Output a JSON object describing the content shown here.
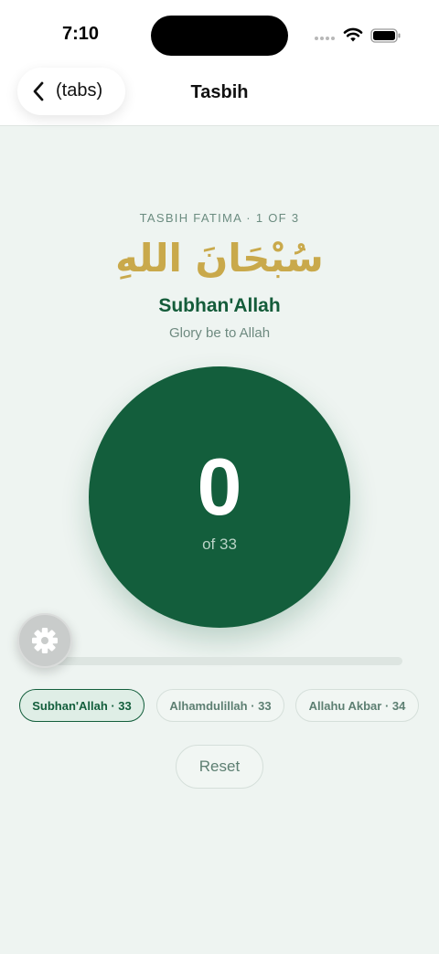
{
  "status_bar": {
    "time": "7:10"
  },
  "nav": {
    "back_label": "(tabs)",
    "title": "Tasbih"
  },
  "dhikr": {
    "set_label": "TASBIH FATIMA · 1 OF 3",
    "arabic": "سُبْحَانَ اللهِ",
    "transliteration": "Subhan'Allah",
    "meaning": "Glory be to Allah"
  },
  "counter": {
    "count": "0",
    "target_label": "of 33"
  },
  "progress": {
    "fraction": 0
  },
  "chips": [
    {
      "label": "Subhan'Allah · 33",
      "active": true
    },
    {
      "label": "Alhamdulillah · 33",
      "active": false
    },
    {
      "label": "Allahu Akbar · 34",
      "active": false
    }
  ],
  "reset_label": "Reset",
  "colors": {
    "primary_green": "#135e3c",
    "gold": "#c9a94b",
    "background": "#eef4f1"
  },
  "icons": {
    "back": "chevron-left-icon",
    "settings": "gear-icon",
    "wifi": "wifi-icon",
    "battery": "battery-icon",
    "signal": "signal-icon"
  }
}
